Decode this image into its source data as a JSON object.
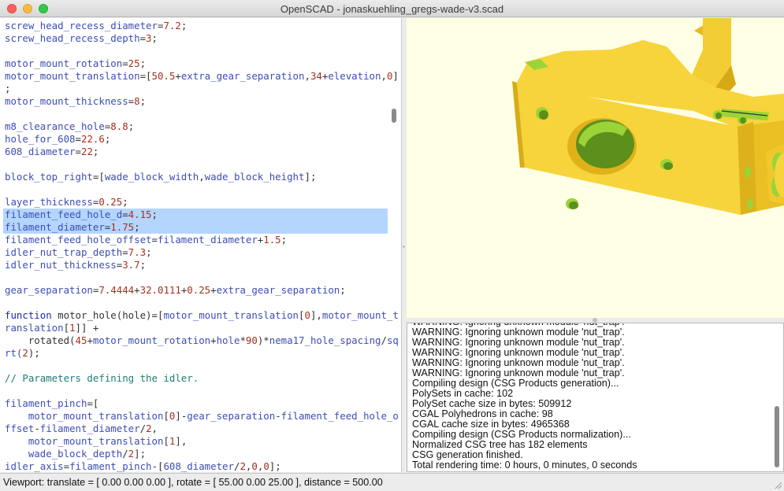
{
  "window": {
    "title": "OpenSCAD - jonaskuehling_gregs-wade-v3.scad"
  },
  "editor": {
    "lines": [
      [
        {
          "t": "screw_head_recess_diameter",
          "c": "v"
        },
        {
          "t": "=",
          "c": "op"
        },
        {
          "t": "7.2",
          "c": "n"
        },
        {
          "t": ";",
          "c": "op"
        }
      ],
      [
        {
          "t": "screw_head_recess_depth",
          "c": "v"
        },
        {
          "t": "=",
          "c": "op"
        },
        {
          "t": "3",
          "c": "n"
        },
        {
          "t": ";",
          "c": "op"
        }
      ],
      [],
      [
        {
          "t": "motor_mount_rotation",
          "c": "v"
        },
        {
          "t": "=",
          "c": "op"
        },
        {
          "t": "25",
          "c": "n"
        },
        {
          "t": ";",
          "c": "op"
        }
      ],
      [
        {
          "t": "motor_mount_translation",
          "c": "v"
        },
        {
          "t": "=[",
          "c": "op"
        },
        {
          "t": "50.5",
          "c": "n"
        },
        {
          "t": "+",
          "c": "op"
        },
        {
          "t": "extra_gear_separation",
          "c": "v"
        },
        {
          "t": ",",
          "c": "op"
        },
        {
          "t": "34",
          "c": "n"
        },
        {
          "t": "+",
          "c": "op"
        },
        {
          "t": "elevation",
          "c": "v"
        },
        {
          "t": ",",
          "c": "op"
        },
        {
          "t": "0",
          "c": "n"
        },
        {
          "t": "]",
          "c": "op"
        }
      ],
      [
        {
          "t": ";",
          "c": "op"
        }
      ],
      [
        {
          "t": "motor_mount_thickness",
          "c": "v"
        },
        {
          "t": "=",
          "c": "op"
        },
        {
          "t": "8",
          "c": "n"
        },
        {
          "t": ";",
          "c": "op"
        }
      ],
      [],
      [
        {
          "t": "m8_clearance_hole",
          "c": "v"
        },
        {
          "t": "=",
          "c": "op"
        },
        {
          "t": "8.8",
          "c": "n"
        },
        {
          "t": ";",
          "c": "op"
        }
      ],
      [
        {
          "t": "hole_for_608",
          "c": "v"
        },
        {
          "t": "=",
          "c": "op"
        },
        {
          "t": "22.6",
          "c": "n"
        },
        {
          "t": ";",
          "c": "op"
        }
      ],
      [
        {
          "t": "608_diameter",
          "c": "v"
        },
        {
          "t": "=",
          "c": "op"
        },
        {
          "t": "22",
          "c": "n"
        },
        {
          "t": ";",
          "c": "op"
        }
      ],
      [],
      [
        {
          "t": "block_top_right",
          "c": "v"
        },
        {
          "t": "=[",
          "c": "op"
        },
        {
          "t": "wade_block_width",
          "c": "v"
        },
        {
          "t": ",",
          "c": "op"
        },
        {
          "t": "wade_block_height",
          "c": "v"
        },
        {
          "t": "];",
          "c": "op"
        }
      ],
      [],
      [
        {
          "t": "layer_thickness",
          "c": "v"
        },
        {
          "t": "=",
          "c": "op"
        },
        {
          "t": "0.25",
          "c": "n"
        },
        {
          "t": ";",
          "c": "op"
        }
      ],
      [
        {
          "t": "filament_feed_hole_d",
          "c": "v"
        },
        {
          "t": "=",
          "c": "op"
        },
        {
          "t": "4.15",
          "c": "n"
        },
        {
          "t": ";",
          "c": "op"
        }
      ],
      [
        {
          "t": "filament_diameter",
          "c": "v"
        },
        {
          "t": "=",
          "c": "op"
        },
        {
          "t": "1.75",
          "c": "n"
        },
        {
          "t": ";",
          "c": "op"
        }
      ],
      [
        {
          "t": "filament_feed_hole_offset",
          "c": "v"
        },
        {
          "t": "=",
          "c": "op"
        },
        {
          "t": "filament_diameter",
          "c": "v"
        },
        {
          "t": "+",
          "c": "op"
        },
        {
          "t": "1.5",
          "c": "n"
        },
        {
          "t": ";",
          "c": "op"
        }
      ],
      [
        {
          "t": "idler_nut_trap_depth",
          "c": "v"
        },
        {
          "t": "=",
          "c": "op"
        },
        {
          "t": "7.3",
          "c": "n"
        },
        {
          "t": ";",
          "c": "op"
        }
      ],
      [
        {
          "t": "idler_nut_thickness",
          "c": "v"
        },
        {
          "t": "=",
          "c": "op"
        },
        {
          "t": "3.7",
          "c": "n"
        },
        {
          "t": ";",
          "c": "op"
        }
      ],
      [],
      [
        {
          "t": "gear_separation",
          "c": "v"
        },
        {
          "t": "=",
          "c": "op"
        },
        {
          "t": "7.4444",
          "c": "n"
        },
        {
          "t": "+",
          "c": "op"
        },
        {
          "t": "32.0111",
          "c": "n"
        },
        {
          "t": "+",
          "c": "op"
        },
        {
          "t": "0.25",
          "c": "n"
        },
        {
          "t": "+",
          "c": "op"
        },
        {
          "t": "extra_gear_separation",
          "c": "v"
        },
        {
          "t": ";",
          "c": "op"
        }
      ],
      [],
      [
        {
          "t": "function",
          "c": "k"
        },
        {
          "t": " motor_hole(hole)=[",
          "c": "op"
        },
        {
          "t": "motor_mount_translation",
          "c": "v"
        },
        {
          "t": "[",
          "c": "op"
        },
        {
          "t": "0",
          "c": "n"
        },
        {
          "t": "],",
          "c": "op"
        },
        {
          "t": "motor_mount_t",
          "c": "v"
        }
      ],
      [
        {
          "t": "ranslation",
          "c": "v"
        },
        {
          "t": "[",
          "c": "op"
        },
        {
          "t": "1",
          "c": "n"
        },
        {
          "t": "]] +",
          "c": "op"
        }
      ],
      [
        {
          "t": "    rotated(",
          "c": "op"
        },
        {
          "t": "45",
          "c": "n"
        },
        {
          "t": "+",
          "c": "op"
        },
        {
          "t": "motor_mount_rotation",
          "c": "v"
        },
        {
          "t": "+",
          "c": "op"
        },
        {
          "t": "hole",
          "c": "v"
        },
        {
          "t": "*",
          "c": "op"
        },
        {
          "t": "90",
          "c": "n"
        },
        {
          "t": ")*",
          "c": "op"
        },
        {
          "t": "nema17_hole_spacing",
          "c": "v"
        },
        {
          "t": "/",
          "c": "op"
        },
        {
          "t": "sq",
          "c": "v"
        }
      ],
      [
        {
          "t": "rt(",
          "c": "v"
        },
        {
          "t": "2",
          "c": "n"
        },
        {
          "t": ");",
          "c": "op"
        }
      ],
      [],
      [
        {
          "t": "// Parameters defining the idler.",
          "c": "c"
        }
      ],
      [],
      [
        {
          "t": "filament_pinch",
          "c": "v"
        },
        {
          "t": "=[",
          "c": "op"
        }
      ],
      [
        {
          "t": "    motor_mount_translation",
          "c": "v"
        },
        {
          "t": "[",
          "c": "op"
        },
        {
          "t": "0",
          "c": "n"
        },
        {
          "t": "]-",
          "c": "op"
        },
        {
          "t": "gear_separation",
          "c": "v"
        },
        {
          "t": "-",
          "c": "op"
        },
        {
          "t": "filament_feed_hole_o",
          "c": "v"
        }
      ],
      [
        {
          "t": "ffset",
          "c": "v"
        },
        {
          "t": "-",
          "c": "op"
        },
        {
          "t": "filament_diameter",
          "c": "v"
        },
        {
          "t": "/",
          "c": "op"
        },
        {
          "t": "2",
          "c": "n"
        },
        {
          "t": ",",
          "c": "op"
        }
      ],
      [
        {
          "t": "    motor_mount_translation",
          "c": "v"
        },
        {
          "t": "[",
          "c": "op"
        },
        {
          "t": "1",
          "c": "n"
        },
        {
          "t": "],",
          "c": "op"
        }
      ],
      [
        {
          "t": "    wade_block_depth",
          "c": "v"
        },
        {
          "t": "/",
          "c": "op"
        },
        {
          "t": "2",
          "c": "n"
        },
        {
          "t": "];",
          "c": "op"
        }
      ],
      [
        {
          "t": "idler_axis",
          "c": "v"
        },
        {
          "t": "=",
          "c": "op"
        },
        {
          "t": "filament_pinch",
          "c": "v"
        },
        {
          "t": "-[",
          "c": "op"
        },
        {
          "t": "608_diameter",
          "c": "v"
        },
        {
          "t": "/",
          "c": "op"
        },
        {
          "t": "2",
          "c": "n"
        },
        {
          "t": ",",
          "c": "op"
        },
        {
          "t": "0",
          "c": "n"
        },
        {
          "t": ",",
          "c": "op"
        },
        {
          "t": "0",
          "c": "n"
        },
        {
          "t": "];",
          "c": "op"
        }
      ]
    ],
    "selected_lines": [
      15,
      16
    ]
  },
  "console": {
    "lines": [
      "WARNING: Ignoring unknown module 'nut_trap'.",
      "WARNING: Ignoring unknown module 'nut_trap'.",
      "WARNING: Ignoring unknown module 'nut_trap'.",
      "WARNING: Ignoring unknown module 'nut_trap'.",
      "WARNING: Ignoring unknown module 'nut_trap'.",
      "WARNING: Ignoring unknown module 'nut_trap'.",
      "Compiling design (CSG Products generation)...",
      "PolySets in cache: 102",
      "PolySet cache size in bytes: 509912",
      "CGAL Polyhedrons in cache: 98",
      "CGAL cache size in bytes: 4965368",
      "Compiling design (CSG Products normalization)...",
      "Normalized CSG tree has 182 elements",
      "CSG generation finished.",
      "Total rendering time: 0 hours, 0 minutes, 0 seconds"
    ]
  },
  "statusbar": {
    "viewport_text": "Viewport: translate = [ 0.00 0.00 0.00 ], rotate = [ 55.00 0.00 25.00 ], distance = 500.00"
  },
  "colors": {
    "model_face": "#f7d43b",
    "model_side": "#e0b21a",
    "model_shadow": "#c89a10",
    "model_hole": "#9bd437",
    "model_hole_dark": "#5c8f1c",
    "viewport_bg": "#ffffe5"
  }
}
